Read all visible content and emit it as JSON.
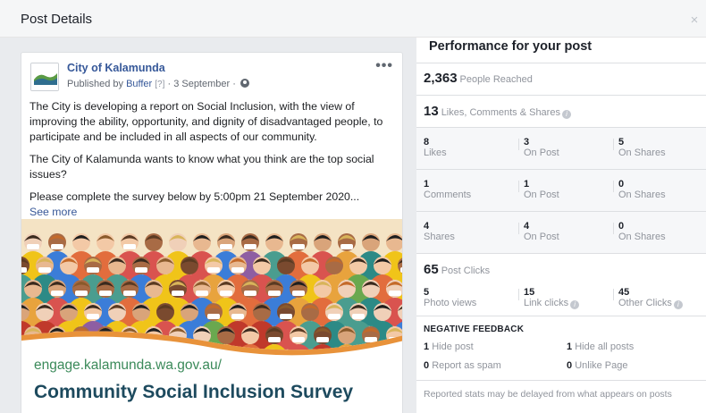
{
  "dialog": {
    "title": "Post Details",
    "close_label": "×"
  },
  "post": {
    "page_name": "City of Kalamunda",
    "logo_label": "Kalamunda",
    "published_prefix": "Published by",
    "publisher": "Buffer",
    "help_marker": "[?]",
    "date": "3 September",
    "more_label": "•••",
    "paragraphs": [
      "The City is developing a report on Social Inclusion, with the view of improving the ability, opportunity, and dignity of disadvantaged people, to participate and be included in all aspects of our community.",
      "The City of Kalamunda wants to know what you think are the top social issues?",
      "Please complete the survey below by 5:00pm 21 September 2020..."
    ],
    "see_more": "See more",
    "image": {
      "url_text": "engage.kalamunda.wa.gov.au/",
      "headline": "Community Social Inclusion Survey",
      "crowd_colors": [
        "#e8a33d",
        "#d9534f",
        "#4a9d8f",
        "#8e5ea2",
        "#f0c419",
        "#3b7dd8",
        "#e26d3d",
        "#6aa84f",
        "#c0392b",
        "#2c8a86"
      ]
    }
  },
  "performance": {
    "title": "Performance for your post",
    "reached": {
      "value": "2,363",
      "label": "People Reached"
    },
    "engagement": {
      "value": "13",
      "label": "Likes, Comments & Shares"
    },
    "rows": [
      {
        "cells": [
          {
            "n": "8",
            "l": "Likes"
          },
          {
            "n": "3",
            "l": "On Post"
          },
          {
            "n": "5",
            "l": "On Shares"
          }
        ]
      },
      {
        "cells": [
          {
            "n": "1",
            "l": "Comments"
          },
          {
            "n": "1",
            "l": "On Post"
          },
          {
            "n": "0",
            "l": "On Shares"
          }
        ]
      },
      {
        "cells": [
          {
            "n": "4",
            "l": "Shares"
          },
          {
            "n": "4",
            "l": "On Post"
          },
          {
            "n": "0",
            "l": "On Shares"
          }
        ]
      }
    ],
    "clicks": {
      "value": "65",
      "label": "Post Clicks"
    },
    "click_cells": [
      {
        "n": "5",
        "l": "Photo views"
      },
      {
        "n": "15",
        "l": "Link clicks"
      },
      {
        "n": "45",
        "l": "Other Clicks"
      }
    ],
    "negative": {
      "title": "NEGATIVE FEEDBACK",
      "items": [
        {
          "n": "1",
          "l": "Hide post"
        },
        {
          "n": "1",
          "l": "Hide all posts"
        },
        {
          "n": "0",
          "l": "Report as spam"
        },
        {
          "n": "0",
          "l": "Unlike Page"
        }
      ]
    },
    "note": "Reported stats may be delayed from what appears on posts",
    "info_glyph": "i"
  }
}
